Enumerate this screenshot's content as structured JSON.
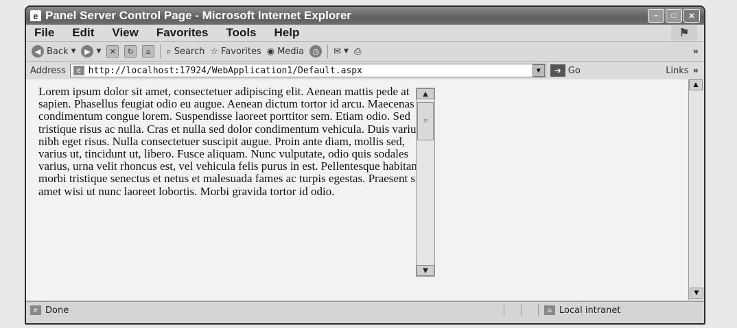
{
  "window": {
    "title": "Panel Server Control Page - Microsoft Internet Explorer",
    "controls": {
      "minimize": "–",
      "maximize": "□",
      "close": "✕"
    }
  },
  "menu": {
    "items": [
      "File",
      "Edit",
      "View",
      "Favorites",
      "Tools",
      "Help"
    ],
    "logo_icon": "windows-flag-icon"
  },
  "toolbar": {
    "back_label": "Back",
    "search_label": "Search",
    "favorites_label": "Favorites",
    "media_label": "Media",
    "overflow": "»"
  },
  "address": {
    "label": "Address",
    "url": "http://localhost:17924/WebApplication1/Default.aspx",
    "go_label": "Go",
    "links_label": "Links",
    "links_overflow": "»"
  },
  "panel": {
    "text": "Lorem ipsum dolor sit amet, consectetuer adipiscing elit. Aenean mattis pede at sapien. Phasellus feugiat odio eu augue. Aenean dictum tortor id arcu. Maecenas condimentum congue lorem. Suspendisse laoreet porttitor sem. Etiam odio. Sed tristique risus ac nulla. Cras et nulla sed dolor condimentum vehicula. Duis varius nibh eget risus. Nulla consectetuer suscipit augue. Proin ante diam, mollis sed, varius ut, tincidunt ut, libero. Fusce aliquam. Nunc vulputate, odio quis sodales varius, urna velit rhoncus est, vel vehicula felis purus in est. Pellentesque habitant morbi tristique senectus et netus et malesuada fames ac turpis egestas. Praesent sit amet wisi ut nunc laoreet lobortis. Morbi gravida tortor id odio."
  },
  "status": {
    "text": "Done",
    "zone": "Local intranet"
  }
}
